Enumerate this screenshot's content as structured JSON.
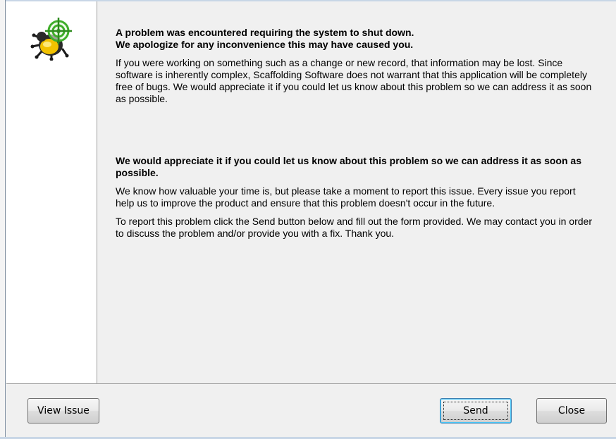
{
  "dialog": {
    "heading1": "A problem was encountered requiring the system to shut down.\nWe apologize for any  inconvenience this may have caused you.",
    "paragraph1": "If you were working on something such as a change or new record, that information may be lost. Since software is inherently complex, Scaffolding Software does not warrant that this application will be completely free of bugs. We would appreciate it if you could let us know about this problem so we can address it as soon as possible.",
    "heading2": "We would appreciate it if you could let us know about this problem so we can address it as soon as possible.",
    "paragraph2": "We know how valuable your time is, but please take a moment to report this issue. Every issue you report help us to improve the product and ensure that this problem doesn't occur in the future.",
    "paragraph3": "To report this problem click the Send button below and fill out the form provided. We may contact you in order to discuss the problem and/or provide you with a fix. Thank you."
  },
  "buttons": {
    "view_issue": "View Issue",
    "send": "Send",
    "close": "Close"
  },
  "icons": {
    "app_icon": "bug-target-icon"
  },
  "colors": {
    "dialog_background": "#f0f0f0",
    "icon_panel_background": "#ffffff",
    "bug_body": "#f2c200",
    "target": "#3fae2a"
  }
}
